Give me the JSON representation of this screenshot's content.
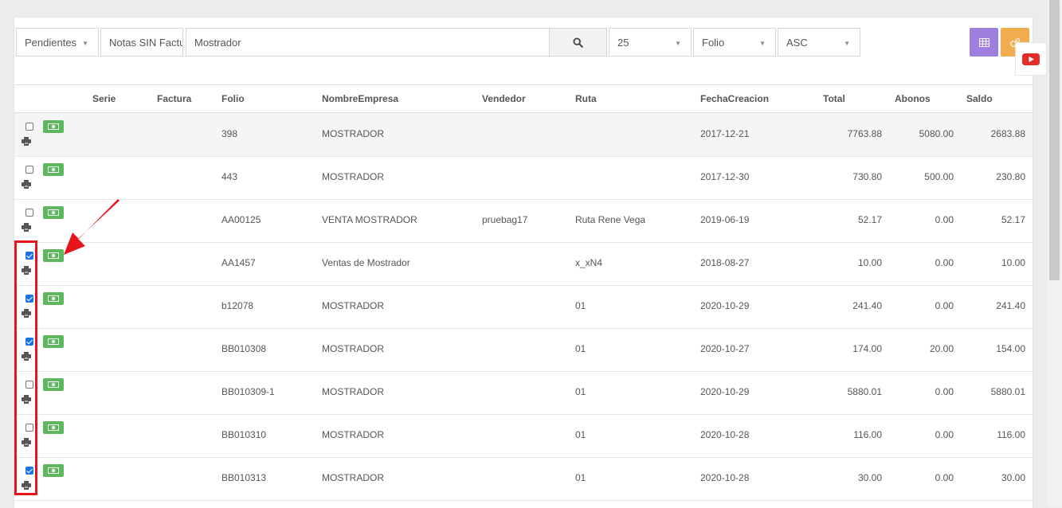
{
  "toolbar": {
    "status_filter": "Pendientes",
    "notes_filter": "Notas SIN Factura",
    "search_value": "Mostrador",
    "search_icon": "search-icon",
    "page_size": "25",
    "sort_field": "Folio",
    "sort_order": "ASC",
    "grid_button_color": "#9e7fe0",
    "settings_button_color": "#f0ad4e",
    "youtube_color": "#e52d27"
  },
  "table": {
    "columns": [
      "Serie",
      "Factura",
      "Folio",
      "NombreEmpresa",
      "Vendedor",
      "Ruta",
      "FechaCreacion",
      "Total",
      "Abonos",
      "Saldo"
    ],
    "rows": [
      {
        "checked": false,
        "serie": "",
        "factura": "",
        "folio": "398",
        "empresa": "MOSTRADOR",
        "vendedor": "",
        "ruta": "",
        "fecha": "2017-12-21",
        "total": "7763.88",
        "abonos": "5080.00",
        "saldo": "2683.88"
      },
      {
        "checked": false,
        "serie": "",
        "factura": "",
        "folio": "443",
        "empresa": "MOSTRADOR",
        "vendedor": "",
        "ruta": "",
        "fecha": "2017-12-30",
        "total": "730.80",
        "abonos": "500.00",
        "saldo": "230.80"
      },
      {
        "checked": false,
        "serie": "",
        "factura": "",
        "folio": "AA00125",
        "empresa": "VENTA MOSTRADOR",
        "vendedor": "pruebag17",
        "ruta": "Ruta Rene Vega",
        "fecha": "2019-06-19",
        "total": "52.17",
        "abonos": "0.00",
        "saldo": "52.17"
      },
      {
        "checked": true,
        "serie": "",
        "factura": "",
        "folio": "AA1457",
        "empresa": "Ventas de Mostrador",
        "vendedor": "",
        "ruta": "x_xN4",
        "fecha": "2018-08-27",
        "total": "10.00",
        "abonos": "0.00",
        "saldo": "10.00"
      },
      {
        "checked": true,
        "serie": "",
        "factura": "",
        "folio": "b12078",
        "empresa": "MOSTRADOR",
        "vendedor": "",
        "ruta": "01",
        "fecha": "2020-10-29",
        "total": "241.40",
        "abonos": "0.00",
        "saldo": "241.40"
      },
      {
        "checked": true,
        "serie": "",
        "factura": "",
        "folio": "BB010308",
        "empresa": "MOSTRADOR",
        "vendedor": "",
        "ruta": "01",
        "fecha": "2020-10-27",
        "total": "174.00",
        "abonos": "20.00",
        "saldo": "154.00"
      },
      {
        "checked": false,
        "serie": "",
        "factura": "",
        "folio": "BB010309-1",
        "empresa": "MOSTRADOR",
        "vendedor": "",
        "ruta": "01",
        "fecha": "2020-10-29",
        "total": "5880.01",
        "abonos": "0.00",
        "saldo": "5880.01"
      },
      {
        "checked": false,
        "serie": "",
        "factura": "",
        "folio": "BB010310",
        "empresa": "MOSTRADOR",
        "vendedor": "",
        "ruta": "01",
        "fecha": "2020-10-28",
        "total": "116.00",
        "abonos": "0.00",
        "saldo": "116.00"
      },
      {
        "checked": true,
        "serie": "",
        "factura": "",
        "folio": "BB010313",
        "empresa": "MOSTRADOR",
        "vendedor": "",
        "ruta": "01",
        "fecha": "2020-10-28",
        "total": "30.00",
        "abonos": "0.00",
        "saldo": "30.00"
      }
    ]
  },
  "annotation": {
    "highlight_color": "#e8141c"
  }
}
